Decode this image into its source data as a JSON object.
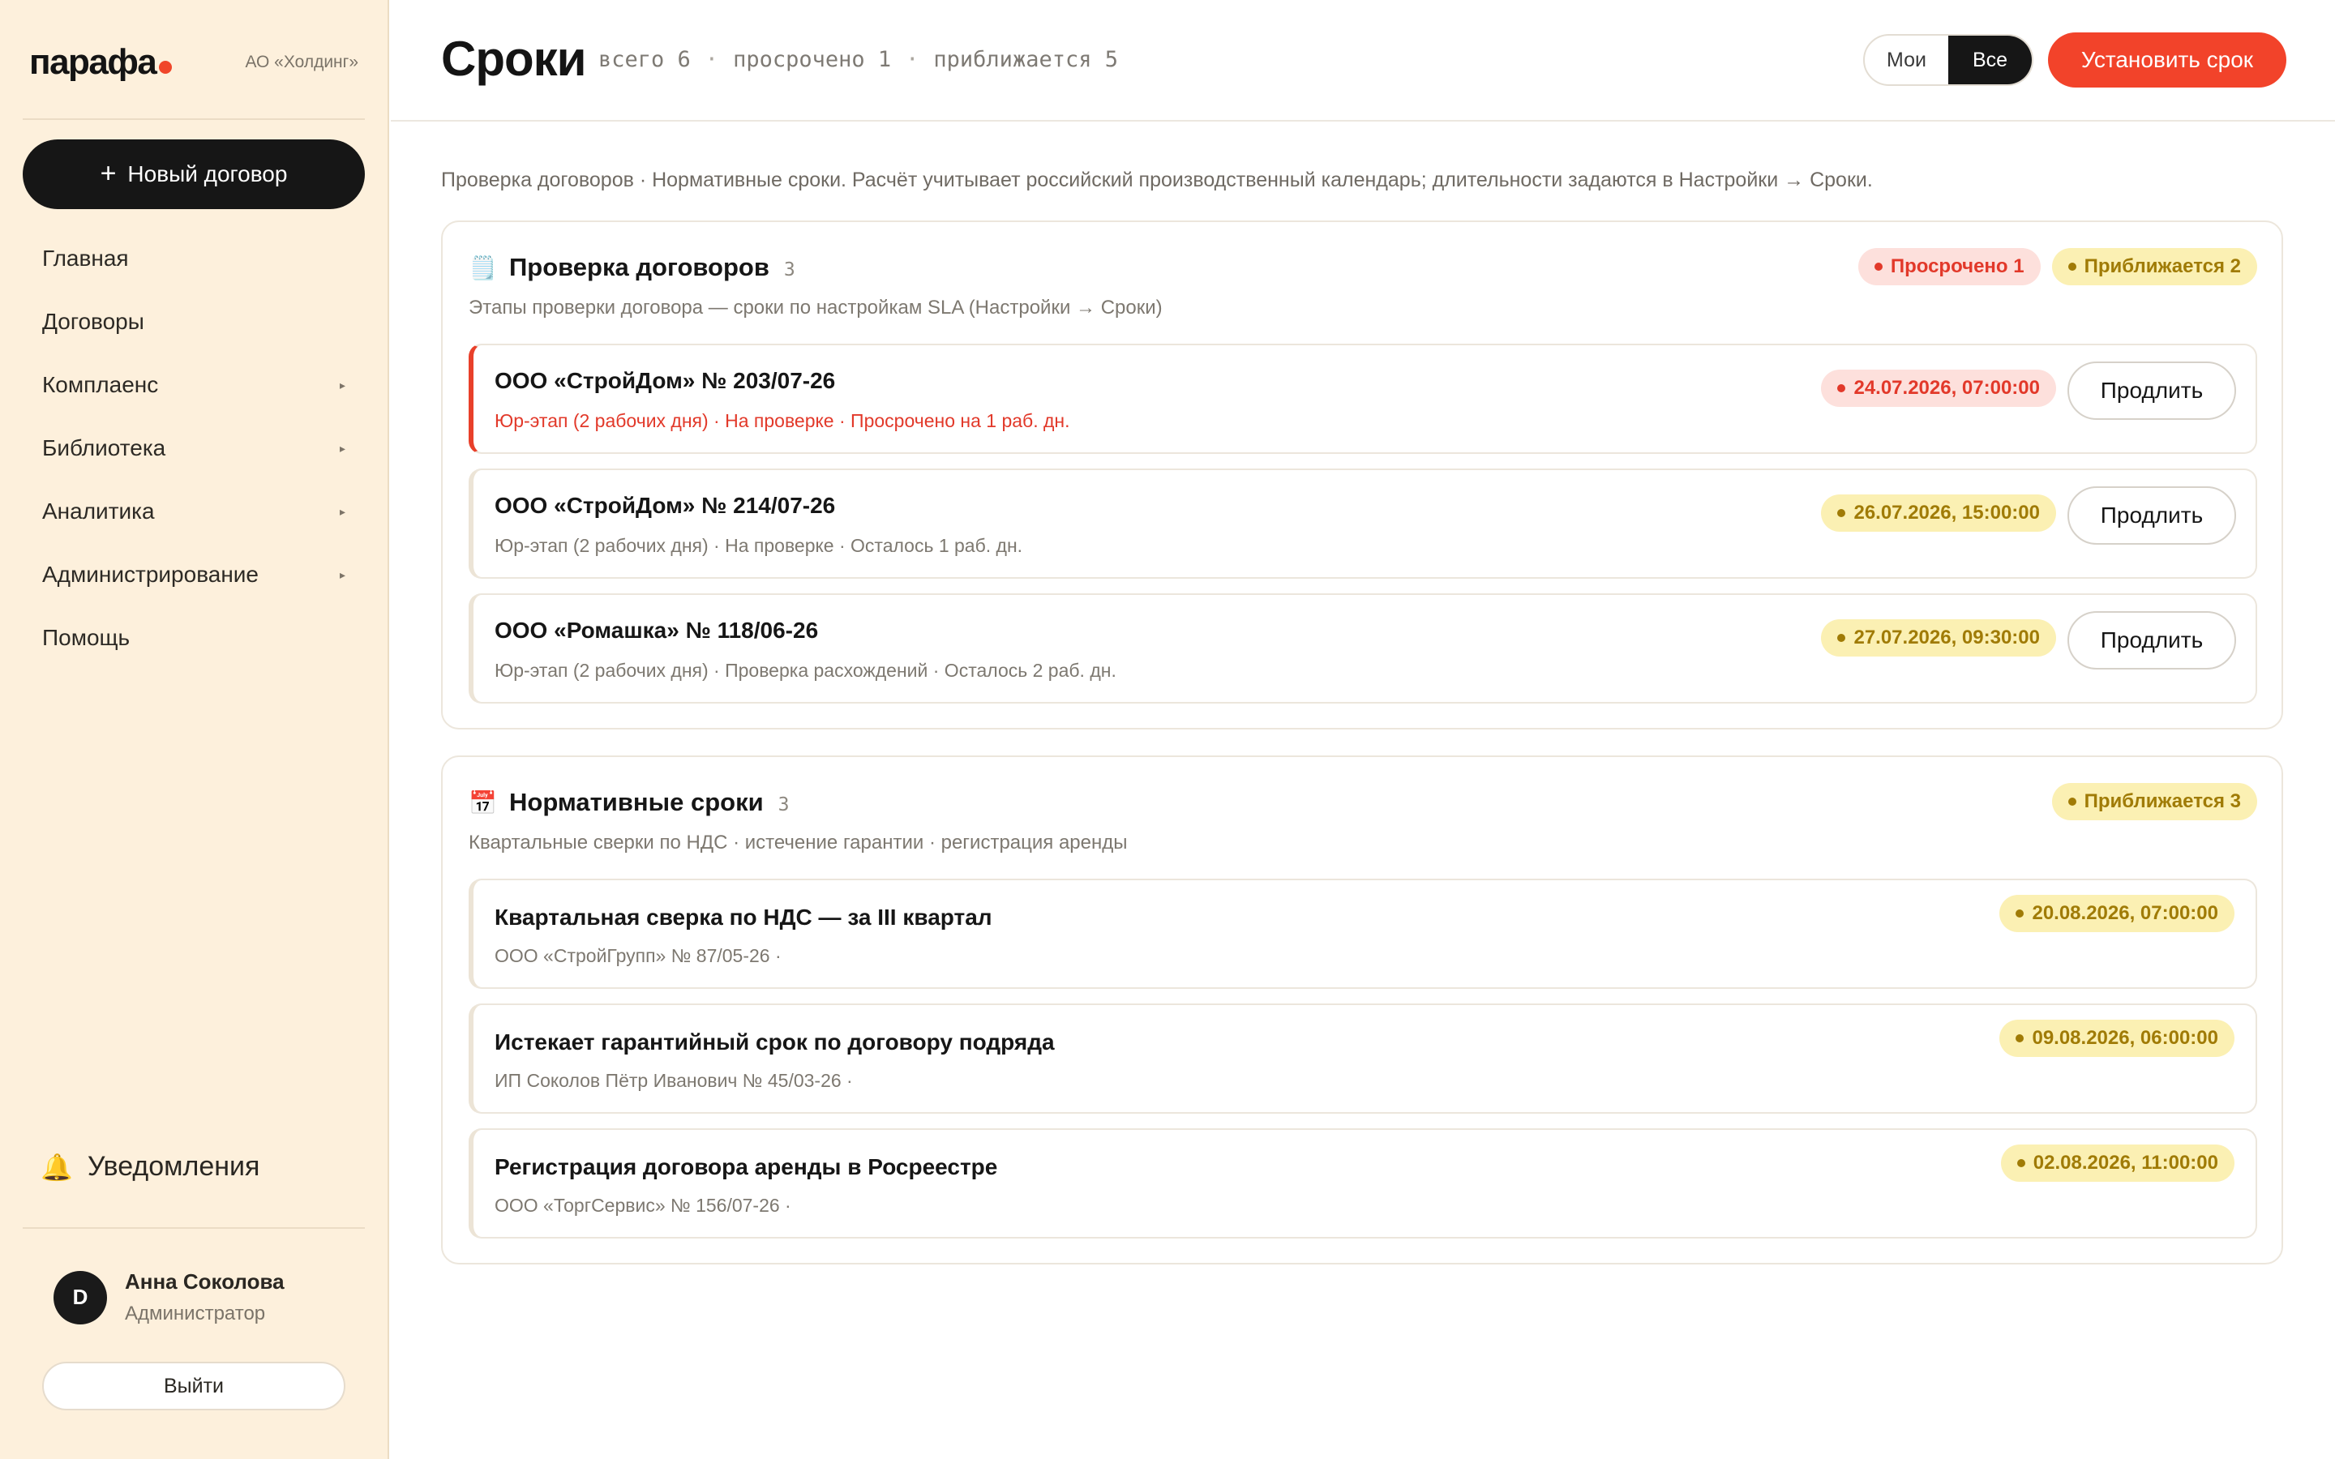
{
  "sidebar": {
    "logo": "парафа",
    "org": "АО «Холдинг»",
    "new_contract_label": "Новый договор",
    "nav": [
      {
        "label": "Главная",
        "has_submenu": false
      },
      {
        "label": "Договоры",
        "has_submenu": false
      },
      {
        "label": "Комплаенс",
        "has_submenu": true
      },
      {
        "label": "Библиотека",
        "has_submenu": true
      },
      {
        "label": "Аналитика",
        "has_submenu": true
      },
      {
        "label": "Администрирование",
        "has_submenu": true
      },
      {
        "label": "Помощь",
        "has_submenu": false
      }
    ],
    "notifications_label": "Уведомления",
    "user": {
      "initial": "D",
      "name": "Анна Соколова",
      "role": "Администратор"
    },
    "logout_label": "Выйти"
  },
  "header": {
    "title": "Сроки",
    "count_total": "всего 6",
    "count_overdue": "просрочено 1",
    "count_upcoming": "приближается 5",
    "separator": "·",
    "toggle": {
      "mine": "Мои",
      "all": "Все",
      "active": "all"
    },
    "set_deadline_label": "Установить срок"
  },
  "intro": "Проверка договоров · Нормативные сроки. Расчёт учитывает российский производственный календарь; длительности задаются в Настройки → Сроки.",
  "sections": [
    {
      "icon": "🗒️",
      "title": "Проверка договоров",
      "count": "3",
      "subtitle": "Этапы проверки договора — сроки по настройкам SLA (Настройки → Сроки)",
      "badges": [
        {
          "label": "Просрочено 1",
          "tone": "red"
        },
        {
          "label": "Приближается 2",
          "tone": "yellow"
        }
      ],
      "items": [
        {
          "title": "ООО «СтройДом» № 203/07-26",
          "meta": "Юр-этап (2 рабочих дня) · На проверке · Просрочено на 1 раб. дн.",
          "date": "24.07.2026, 07:00:00",
          "status": "overdue",
          "action": "Продлить"
        },
        {
          "title": "ООО «СтройДом» № 214/07-26",
          "meta": "Юр-этап (2 рабочих дня) · На проверке · Осталось 1 раб. дн.",
          "date": "26.07.2026, 15:00:00",
          "status": "upcoming",
          "action": "Продлить"
        },
        {
          "title": "ООО «Ромашка» № 118/06-26",
          "meta": "Юр-этап (2 рабочих дня) · Проверка расхождений · Осталось 2 раб. дн.",
          "date": "27.07.2026, 09:30:00",
          "status": "upcoming",
          "action": "Продлить"
        }
      ]
    },
    {
      "icon": "📅",
      "title": "Нормативные сроки",
      "count": "3",
      "subtitle": "Квартальные сверки по НДС · истечение гарантии · регистрация аренды",
      "badges": [
        {
          "label": "Приближается 3",
          "tone": "yellow"
        }
      ],
      "items": [
        {
          "title": "Квартальная сверка по НДС — за III квартал",
          "meta": "ООО «СтройГрупп» № 87/05-26 ·",
          "date": "20.08.2026, 07:00:00",
          "status": "upcoming",
          "action": ""
        },
        {
          "title": "Истекает гарантийный срок по договору подряда",
          "meta": "ИП Соколов Пётр Иванович № 45/03-26 ·",
          "date": "09.08.2026, 06:00:00",
          "status": "upcoming",
          "action": ""
        },
        {
          "title": "Регистрация договора аренды в Росреестре",
          "meta": "ООО «ТоргСервис» № 156/07-26 ·",
          "date": "02.08.2026, 11:00:00",
          "status": "upcoming",
          "action": ""
        }
      ]
    }
  ],
  "colors": {
    "accent": "#f2432a",
    "sidebar_bg": "#fdf0dc",
    "overdue": "#e2392a",
    "upcoming": "#a07b06",
    "dark": "#161616"
  },
  "icons": {
    "plus": "plus-icon",
    "submenu": "chevron-right-icon",
    "notifications": "bell-icon",
    "section_review": "clipboard-icon",
    "section_normative": "calendar-icon"
  }
}
